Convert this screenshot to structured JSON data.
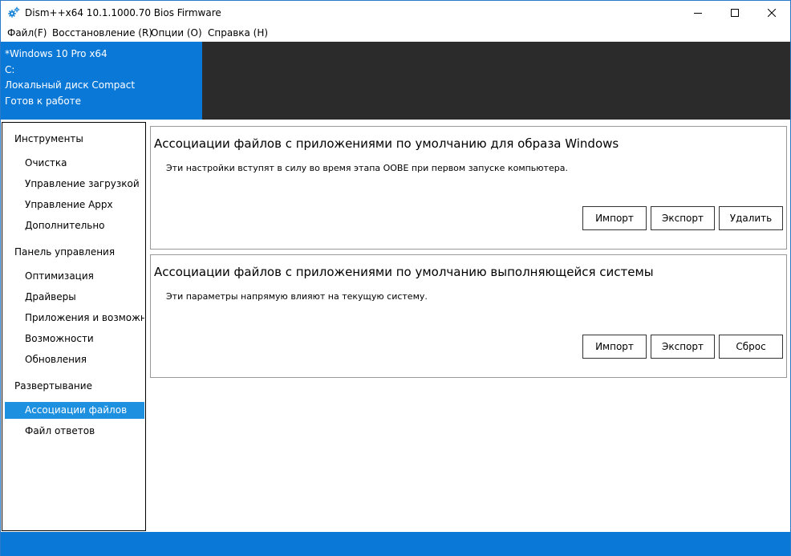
{
  "window": {
    "title": "Dism++x64 10.1.1000.70 Bios Firmware",
    "accent_color": "#0a78d7",
    "selected_color": "#1e90e0",
    "dark_color": "#2b2b2b"
  },
  "menu": {
    "items": [
      "Файл(F)",
      "Восстановление (R)",
      "Опции (O)",
      "Справка (H)"
    ]
  },
  "image_info": {
    "lines": [
      "*Windows 10 Pro x64",
      "C:",
      "Локальный диск Compact",
      "Готов к работе"
    ]
  },
  "sidebar": {
    "groups": [
      {
        "label": "Инструменты",
        "items": [
          "Очистка",
          "Управление загрузкой",
          "Управление Appx",
          "Дополнительно"
        ]
      },
      {
        "label": "Панель управления",
        "items": [
          "Оптимизация",
          "Драйверы",
          "Приложения и возможнос",
          "Возможности",
          "Обновления"
        ]
      },
      {
        "label": "Развертывание",
        "items": [
          "Ассоциации файлов",
          "Файл ответов"
        ]
      }
    ],
    "selected": "Ассоциации файлов"
  },
  "cards": [
    {
      "title": "Ассоциации файлов с приложениями по умолчанию для образа Windows",
      "description": "Эти настройки вступят в силу во время этапа OOBE при первом запуске компьютера.",
      "buttons": [
        "Импорт",
        "Экспорт",
        "Удалить"
      ]
    },
    {
      "title": "Ассоциации файлов с приложениями по умолчанию выполняющейся системы",
      "description": "Эти параметры напрямую влияют на текущую систему.",
      "buttons": [
        "Импорт",
        "Экспорт",
        "Сброс"
      ]
    }
  ]
}
